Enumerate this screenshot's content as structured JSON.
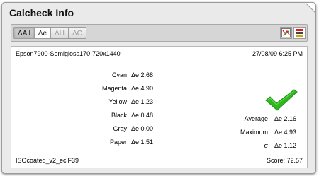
{
  "window": {
    "title": "Calcheck Info"
  },
  "tabs": [
    {
      "label": "ΔAll",
      "state": "active"
    },
    {
      "label": "Δe",
      "state": "on"
    },
    {
      "label": "ΔH",
      "state": "off"
    },
    {
      "label": "ΔC",
      "state": "off"
    }
  ],
  "tools": [
    {
      "icon": "color-chart-icon",
      "state": "active"
    },
    {
      "icon": "color-bars-icon",
      "state": "normal"
    }
  ],
  "header": {
    "profile": "Epson7900-Semigloss170-720x1440",
    "datetime": "27/08/09 6:25 PM"
  },
  "metrics": [
    {
      "name": "Cyan",
      "value": "Δe 2.68"
    },
    {
      "name": "Magenta",
      "value": "Δe 4.90"
    },
    {
      "name": "Yellow",
      "value": "Δe 1.23"
    },
    {
      "name": "Black",
      "value": "Δe 0.48"
    },
    {
      "name": "Gray",
      "value": "Δe 0.00"
    },
    {
      "name": "Paper",
      "value": "Δe 1.51"
    }
  ],
  "stats": [
    {
      "name": "Average",
      "value": "Δe 2.16"
    },
    {
      "name": "Maximum",
      "value": "Δe 4.93"
    },
    {
      "name": "σ",
      "value": "Δe 1.12"
    }
  ],
  "status_icon": "checkmark-icon",
  "colors": {
    "check": "#2db81e",
    "accent_red": "#e11b1b"
  },
  "footer": {
    "reference": "ISOcoated_v2_eciF39",
    "score": "Score: 72.57"
  }
}
